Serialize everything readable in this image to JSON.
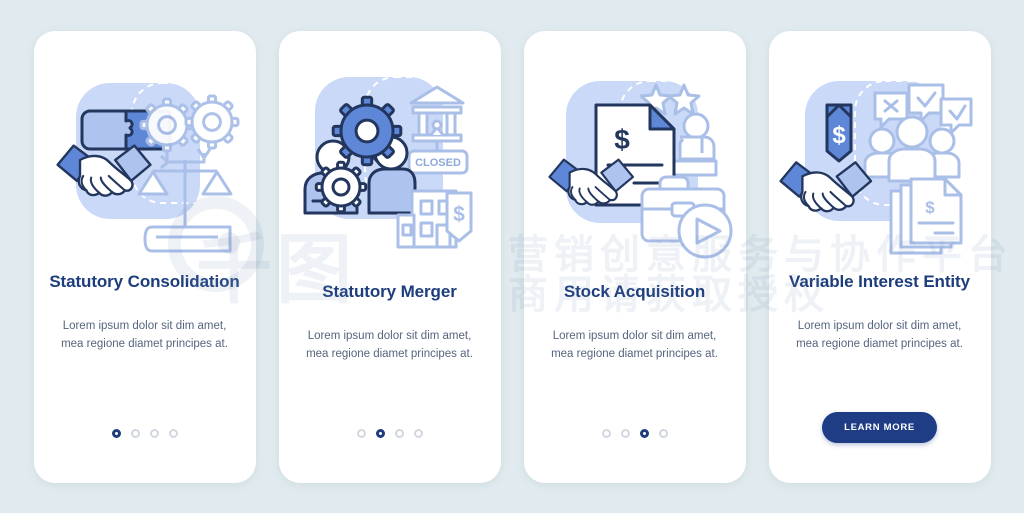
{
  "page": {
    "background_color": "#e1ebef",
    "card_background": "#ffffff",
    "title_color": "#1d3d7c",
    "body_color": "#56657e",
    "accent_blue": "#5f87d8",
    "light_blue": "#aec3ee",
    "blob_color": "#c9d9f7",
    "outline_navy": "#22365e"
  },
  "watermark": {
    "line1": "营销创意服务与协作平台",
    "line2": "商用请获取授权",
    "logo": "千图"
  },
  "screens": [
    {
      "illustration_name": "statutory-consolidation-illustration",
      "illustration_items": [
        "handshake-icon",
        "puzzle-pieces-icon",
        "gears-icon",
        "scales-of-justice-icon",
        "law-book-icon"
      ],
      "title": "Statutory Consolidation",
      "body": "Lorem ipsum dolor sit dim amet, mea regione diamet principes at.",
      "pagination": {
        "total": 4,
        "active": 1
      },
      "cta": null
    },
    {
      "illustration_name": "statutory-merger-illustration",
      "illustration_items": [
        "people-icon",
        "gear-icon",
        "bank-icon",
        "closed-sign-icon",
        "building-icon",
        "dollar-tag-icon"
      ],
      "title": "Statutory Merger",
      "body": "Lorem ipsum dolor sit dim amet, mea regione diamet principes at.",
      "pagination": {
        "total": 4,
        "active": 2
      },
      "cta": null
    },
    {
      "illustration_name": "stock-acquisition-illustration",
      "illustration_items": [
        "handshake-icon",
        "dollar-document-icon",
        "stars-icon",
        "people-icon",
        "briefcase-icon",
        "play-button-icon"
      ],
      "title": "Stock Acquisition",
      "body": "Lorem ipsum dolor sit dim amet, mea regione diamet principes at.",
      "pagination": {
        "total": 4,
        "active": 3
      },
      "cta": null
    },
    {
      "illustration_name": "variable-interest-entity-illustration",
      "illustration_items": [
        "handshake-icon",
        "dollar-price-tag-icon",
        "people-group-icon",
        "speech-bubble-x-icon",
        "speech-bubble-check-icon",
        "documents-icon"
      ],
      "title": "Variable Interest Entity",
      "body": "Lorem ipsum dolor sit dim amet, mea regione diamet principes at.",
      "pagination": null,
      "cta": {
        "label": "LEARN MORE"
      }
    }
  ]
}
